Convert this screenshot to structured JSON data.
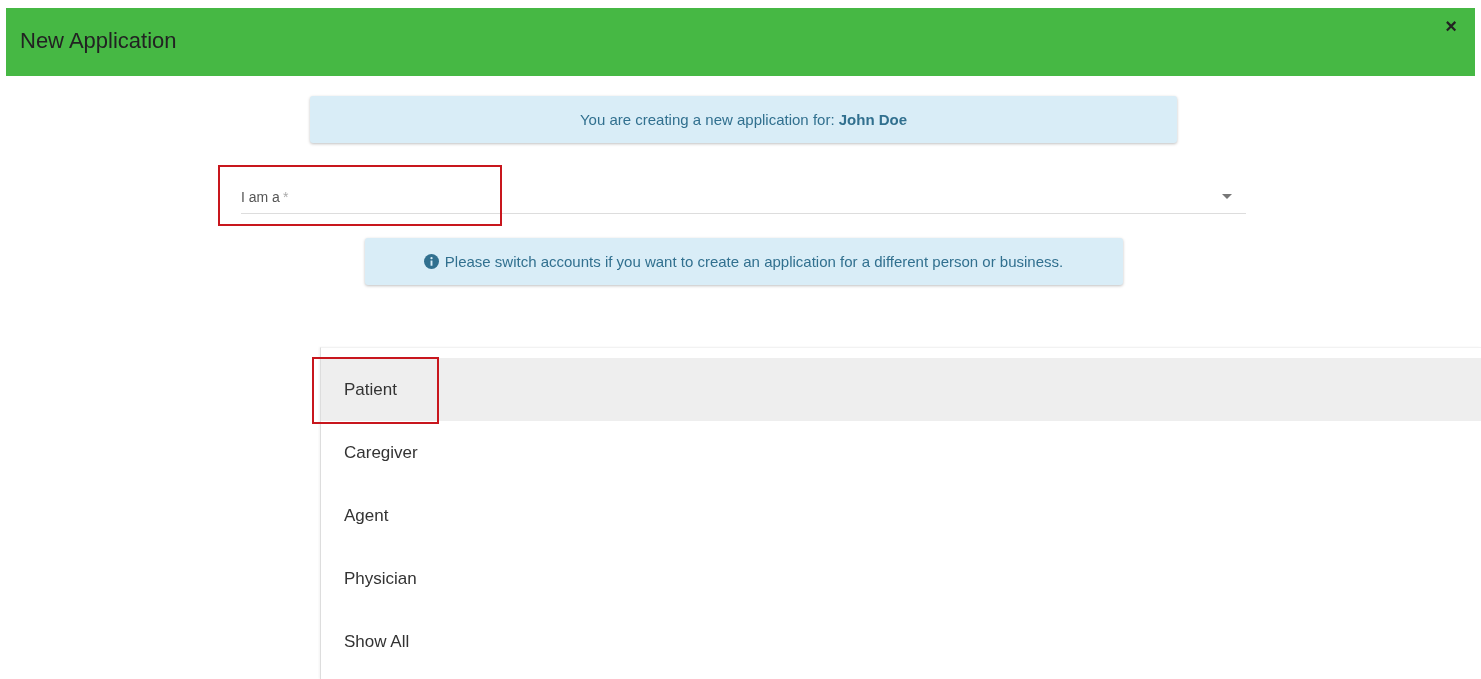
{
  "dialog": {
    "title": "New Application",
    "close": "×"
  },
  "notice": {
    "text": "You are creating a new application for: **John Doe**"
  },
  "field": {
    "label": "I am a",
    "required_mark": "*",
    "highlighted": true
  },
  "hint": {
    "text": "Please switch accounts if you want to create an application for a different person or business."
  },
  "options": [
    {
      "label": "Patient",
      "selected": true,
      "highlighted": true
    },
    {
      "label": "Caregiver",
      "selected": false,
      "highlighted": false
    },
    {
      "label": "Agent",
      "selected": false,
      "highlighted": false
    },
    {
      "label": "Physician",
      "selected": false,
      "highlighted": false
    },
    {
      "label": "Show All",
      "selected": false,
      "highlighted": false
    }
  ]
}
